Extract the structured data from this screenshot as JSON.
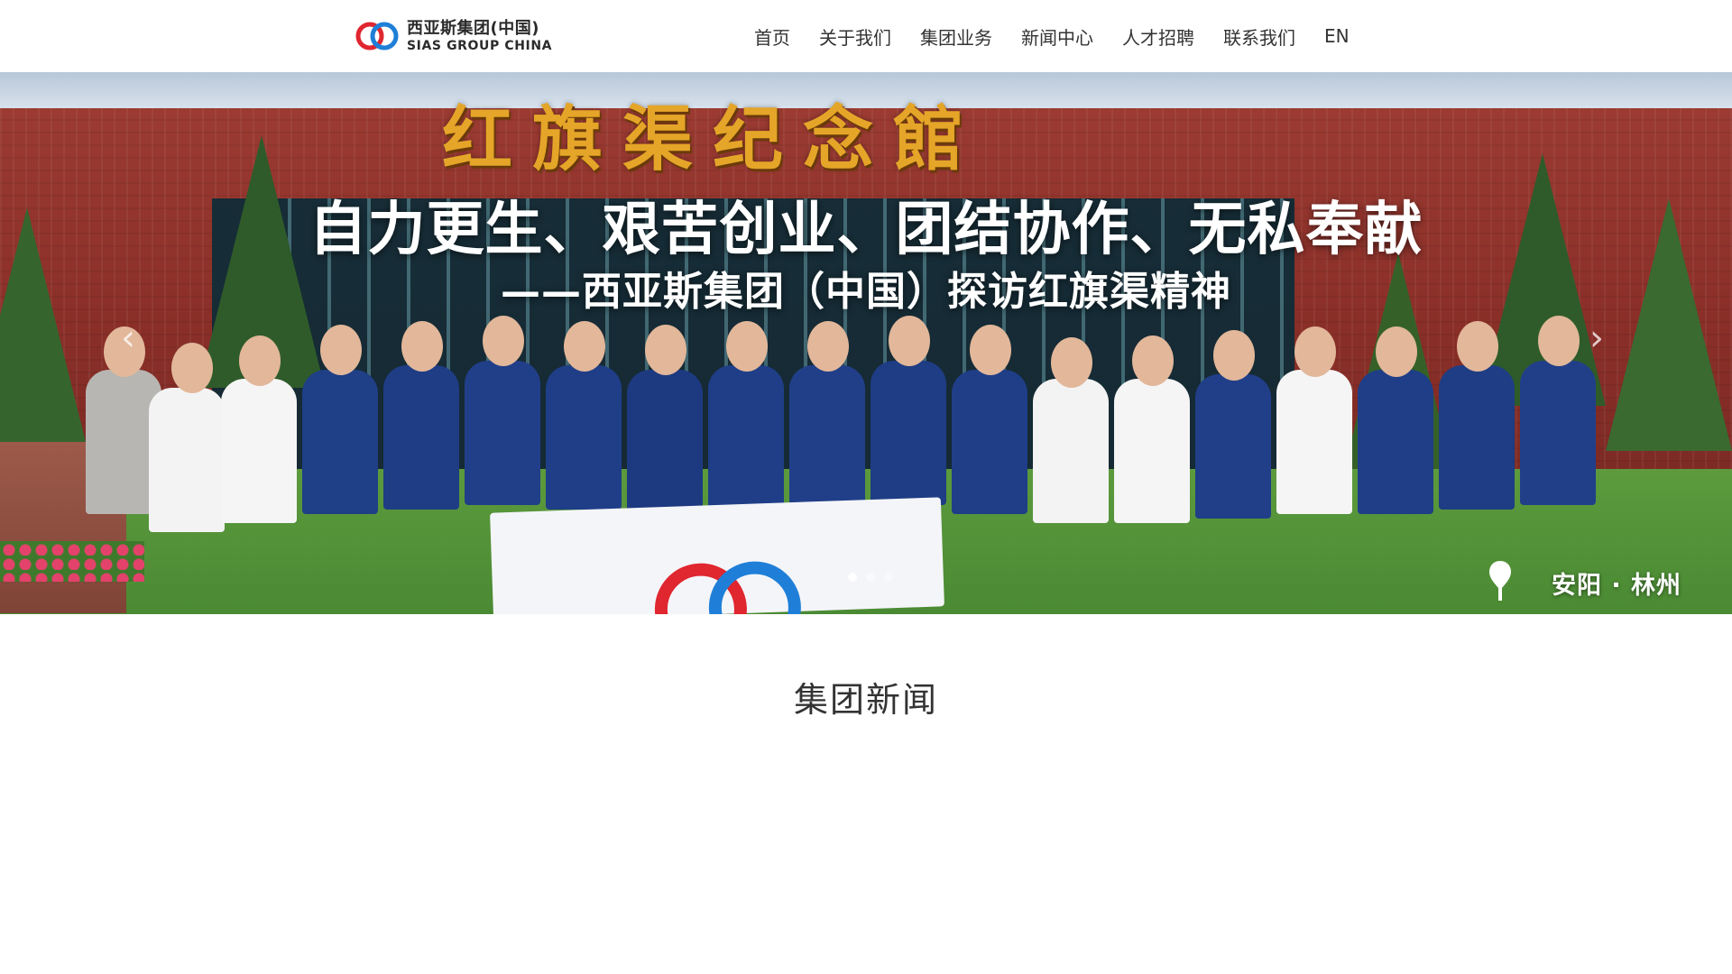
{
  "header": {
    "logo": {
      "name_cn": "西亚斯集团(中国)",
      "name_en": "SIAS GROUP CHINA",
      "colors": {
        "ring_left": "#e0262f",
        "ring_right": "#1f7fd8"
      }
    },
    "nav": [
      {
        "label": "首页"
      },
      {
        "label": "关于我们"
      },
      {
        "label": "集团业务"
      },
      {
        "label": "新闻中心"
      },
      {
        "label": "人才招聘"
      },
      {
        "label": "联系我们"
      },
      {
        "label": "EN"
      }
    ]
  },
  "hero": {
    "building_sign": "红旗渠纪念館",
    "title": "自力更生、艰苦创业、团结协作、无私奉献",
    "subtitle": "——西亚斯集团（中国）探访红旗渠精神",
    "location": "安阳 · 林州",
    "prev_icon": "chevron-left-icon",
    "next_icon": "chevron-right-icon",
    "slides_count": 3,
    "active_slide": 1
  },
  "section": {
    "title": "集团新闻"
  }
}
